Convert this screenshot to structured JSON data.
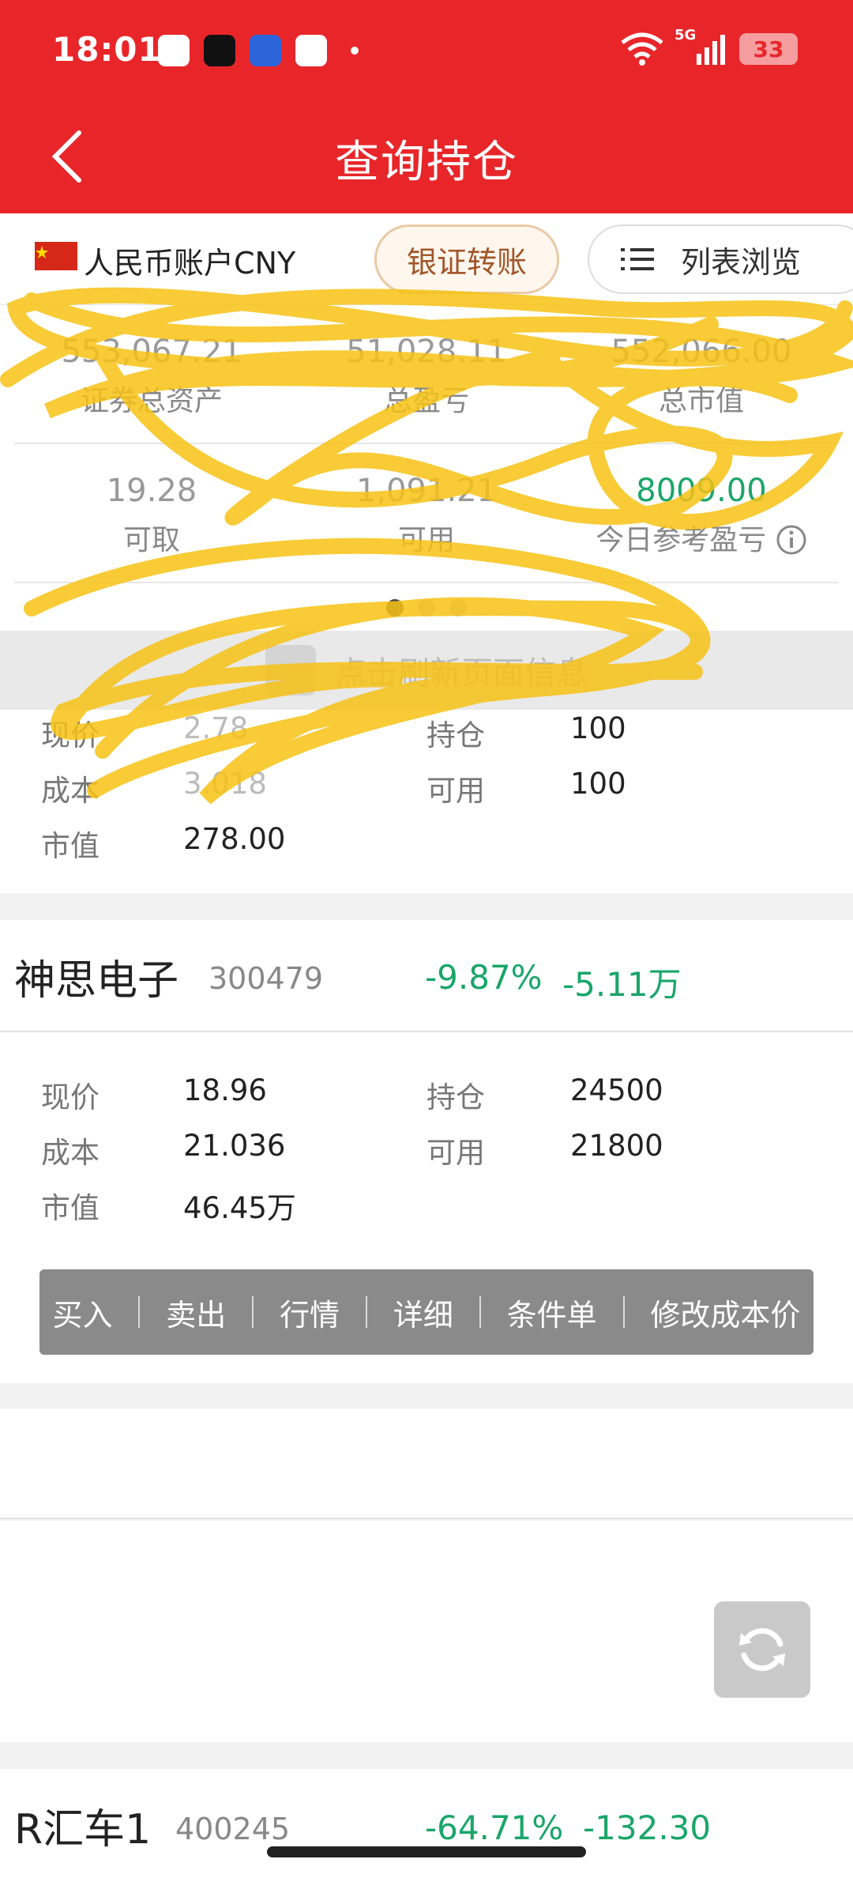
{
  "status_bar": {
    "time": "18:01",
    "network": "5G",
    "battery": "33"
  },
  "header": {
    "title": "查询持仓"
  },
  "account": {
    "name": "人民币账户CNY",
    "transfer_label": "银证转账",
    "list_label": "列表浏览"
  },
  "summary": {
    "row1": [
      {
        "value": "553,067.21",
        "label": "证券总资产"
      },
      {
        "value": "51,028.11",
        "label": "总盈亏"
      },
      {
        "value": "552,066.00",
        "label": "总市值"
      }
    ],
    "row2": [
      {
        "value": "19.28",
        "label": "可取"
      },
      {
        "value": "1,091.21",
        "label": "可用"
      },
      {
        "value": "8009.00",
        "label": "今日参考盈亏"
      }
    ]
  },
  "refresh_text": "点击刷新页面信息",
  "holding1_detail": {
    "price_label": "现价",
    "price": "2.78",
    "cost_label": "成本",
    "cost": "3.018",
    "value_label": "市值",
    "value": "278.00",
    "position_label": "持仓",
    "position": "100",
    "available_label": "可用",
    "available": "100"
  },
  "holding2": {
    "name": "神思电子",
    "code": "300479",
    "pct": "-9.87%",
    "pnl": "-5.11万",
    "price_label": "现价",
    "price": "18.96",
    "cost_label": "成本",
    "cost": "21.036",
    "value_label": "市值",
    "value": "46.45万",
    "position_label": "持仓",
    "position": "24500",
    "available_label": "可用",
    "available": "21800"
  },
  "actions": [
    "买入",
    "卖出",
    "行情",
    "详细",
    "条件单",
    "修改成本价"
  ],
  "holding3": {
    "name": "R汇车1",
    "code": "400245",
    "pct": "-64.71%",
    "pnl": "-132.30"
  },
  "colors": {
    "brand_red": "#e8262a",
    "down_green": "#1aa56a",
    "action_bg": "#8a8a8a"
  }
}
